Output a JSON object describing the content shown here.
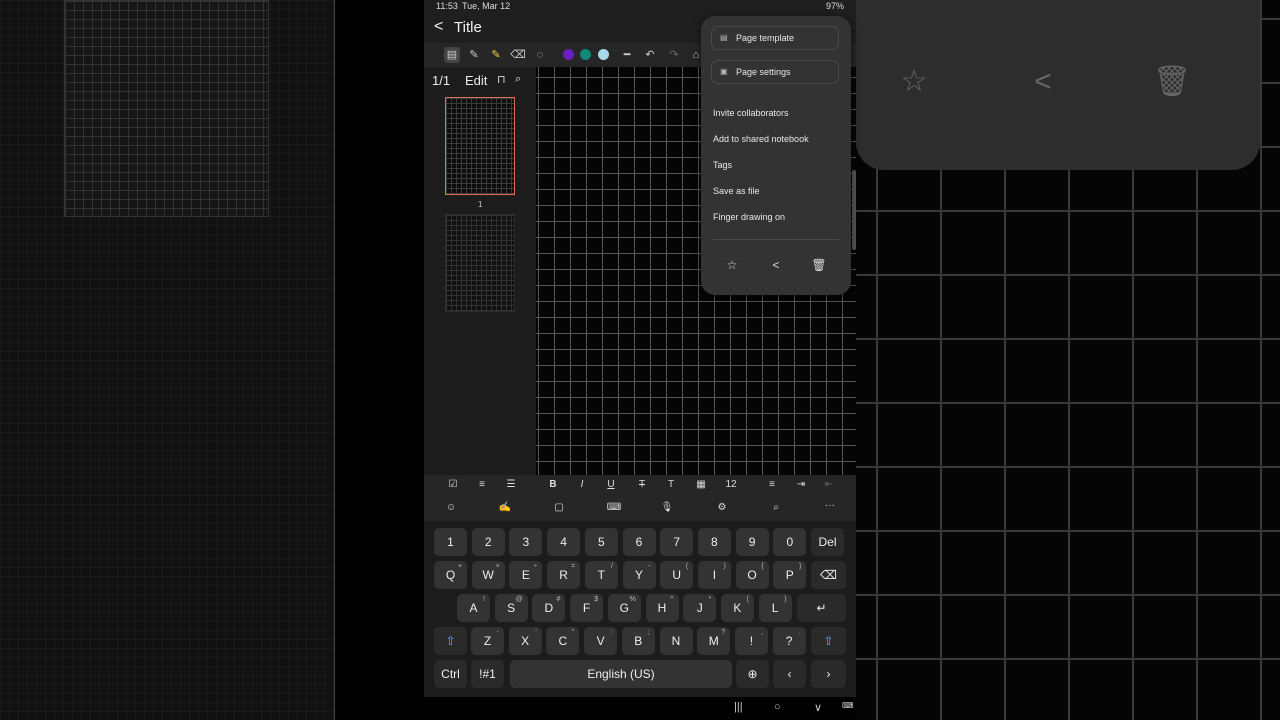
{
  "status": {
    "time": "11:53",
    "date": "Tue, Mar 12",
    "battery": "97%"
  },
  "note": {
    "title": "Title",
    "page_count": "1/1",
    "edit_label": "Edit",
    "page_number": "1"
  },
  "pen_colors": [
    "#6a1fc0",
    "#0f8a7a",
    "#a8d8ea"
  ],
  "format_bar": {
    "font_size": "12"
  },
  "menu": {
    "page_template": "Page template",
    "page_settings": "Page settings",
    "items": [
      "Invite collaborators",
      "Add to shared notebook",
      "Tags",
      "Save as file",
      "Finger drawing on"
    ]
  },
  "keyboard": {
    "row1": [
      "1",
      "2",
      "3",
      "4",
      "5",
      "6",
      "7",
      "8",
      "9",
      "0",
      "Del"
    ],
    "row2": [
      "Q",
      "W",
      "E",
      "R",
      "T",
      "Y",
      "U",
      "I",
      "O",
      "P"
    ],
    "row2_sup": [
      "+",
      "×",
      "÷",
      "=",
      "/",
      "-",
      "(",
      ")",
      "{",
      "}"
    ],
    "row3": [
      "A",
      "S",
      "D",
      "F",
      "G",
      "H",
      "J",
      "K",
      "L"
    ],
    "row3_sup": [
      "!",
      "@",
      "#",
      "$",
      "%",
      "^",
      "*",
      "(",
      ")"
    ],
    "row4": [
      "Z",
      "X",
      "C",
      "V",
      "B",
      "N",
      "M",
      "!",
      "?"
    ],
    "row4_sup": [
      "-",
      "'",
      "\"",
      ":",
      ";",
      "",
      "?",
      ",",
      "."
    ],
    "ctrl": "Ctrl",
    "sym": "!#1",
    "space": "English (US)"
  }
}
